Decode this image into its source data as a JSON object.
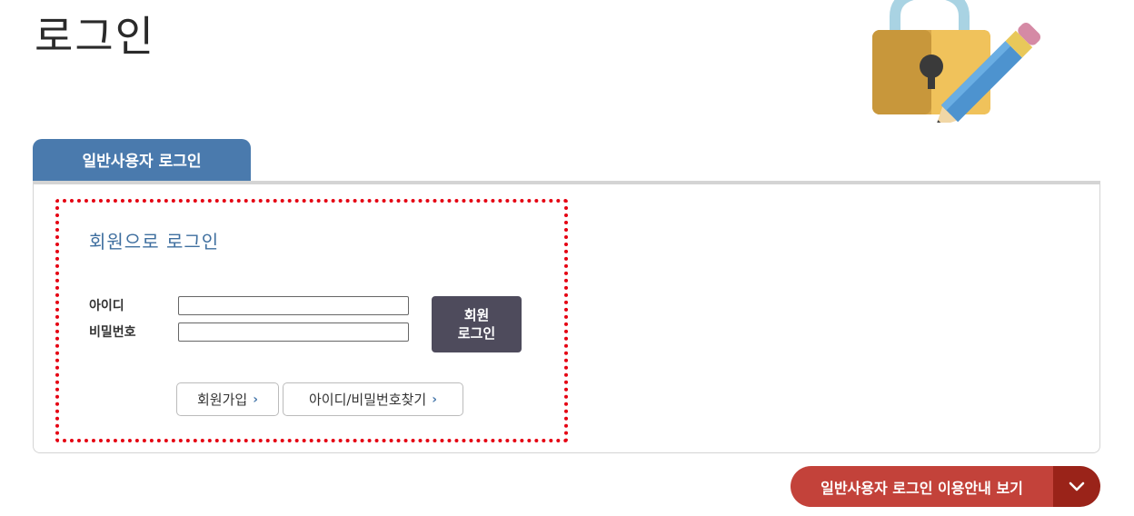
{
  "page": {
    "title": "로그인"
  },
  "tabs": [
    {
      "label": "일반사용자 로그인"
    }
  ],
  "login": {
    "section_title": "회원으로 로그인",
    "id_label": "아이디",
    "pw_label": "비밀번호",
    "id_value": "",
    "pw_value": "",
    "submit_line1": "회원",
    "submit_line2": "로그인",
    "join_label": "회원가입",
    "find_label": "아이디/비밀번호찾기",
    "chevron": "›"
  },
  "guide": {
    "label": "일반사용자 로그인 이용안내 보기",
    "toggle_icon": "chevron-down-icon"
  },
  "colors": {
    "tab": "#4a7aad",
    "section_title": "#3f6f9f",
    "login_button": "#4e4b5c",
    "highlight_border": "#e50012",
    "guide_button": "#c3423a",
    "guide_toggle": "#9a2319"
  }
}
